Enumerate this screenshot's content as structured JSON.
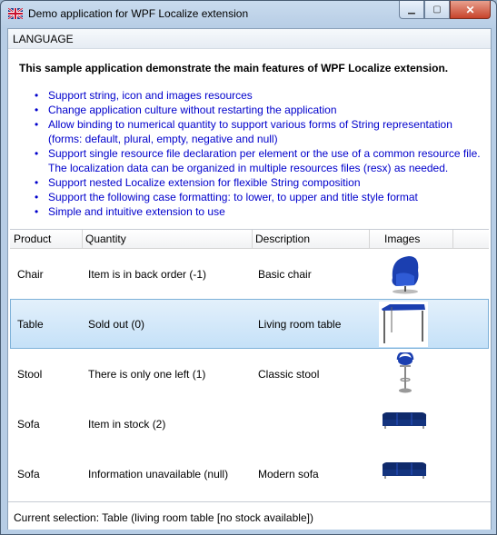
{
  "window": {
    "title": "Demo application for WPF Localize extension"
  },
  "menu": {
    "language_label": "LANGUAGE"
  },
  "intro": "This sample application demonstrate the main features of WPF Localize extension.",
  "features": [
    "Support string, icon and images resources",
    "Change application culture without restarting the application",
    "Allow binding to numerical quantity to support various forms of String representation (forms: default, plural, empty, negative and null)",
    "Support single resource file declaration per element or the use of a common resource file. The localization data can be organized in multiple resources files (resx) as needed.",
    "Support nested Localize extension for flexible String composition",
    "Support the following case formatting: to lower, to upper and title style format",
    "Simple and intuitive extension to use"
  ],
  "grid": {
    "columns": [
      "Product",
      "Quantity",
      "Description",
      "Images"
    ],
    "rows": [
      {
        "product": "Chair",
        "quantity": "Item is in back order (-1)",
        "description": "Basic chair",
        "image_icon": "chair-image"
      },
      {
        "product": "Table",
        "quantity": "Sold out (0)",
        "description": "Living room table",
        "image_icon": "table-image"
      },
      {
        "product": "Stool",
        "quantity": "There is only one left (1)",
        "description": "Classic stool",
        "image_icon": "stool-image"
      },
      {
        "product": "Sofa",
        "quantity": "Item in stock (2)",
        "description": "",
        "image_icon": "sofa-image"
      },
      {
        "product": "Sofa",
        "quantity": "Information unavailable (null)",
        "description": "Modern sofa",
        "image_icon": "sofa-image"
      }
    ],
    "selected_row": 1
  },
  "status": {
    "text": "Current selection: Table (living room table [no stock available])"
  },
  "colors": {
    "link": "#0000cc",
    "selection": "#c5e1f8",
    "furniture": "#1b3fb0"
  }
}
